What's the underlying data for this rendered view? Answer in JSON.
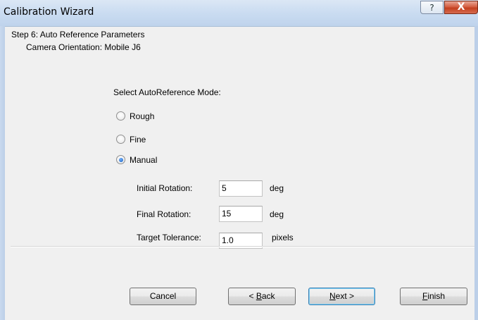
{
  "window": {
    "title": "Calibration Wizard",
    "help_glyph": "?",
    "close_glyph": "X"
  },
  "step": {
    "title": "Step 6: Auto Reference Parameters",
    "subtitle": "Camera Orientation: Mobile J6"
  },
  "mode": {
    "prompt": "Select AutoReference Mode:",
    "options": [
      {
        "label": "Rough",
        "checked": false
      },
      {
        "label": "Fine",
        "checked": false
      },
      {
        "label": "Manual",
        "checked": true
      }
    ]
  },
  "params": [
    {
      "label": "Initial Rotation:",
      "value": "5",
      "unit": "deg"
    },
    {
      "label": "Final Rotation:",
      "value": "15",
      "unit": "deg"
    },
    {
      "label": "Target Tolerance:",
      "value": "1.0",
      "unit": "pixels"
    }
  ],
  "buttons": {
    "cancel": "Cancel",
    "back": {
      "prefix": "< ",
      "mnemonic": "B",
      "rest": "ack"
    },
    "next": {
      "mnemonic": "N",
      "rest": "ext >"
    },
    "finish": {
      "mnemonic": "F",
      "rest": "inish"
    }
  }
}
